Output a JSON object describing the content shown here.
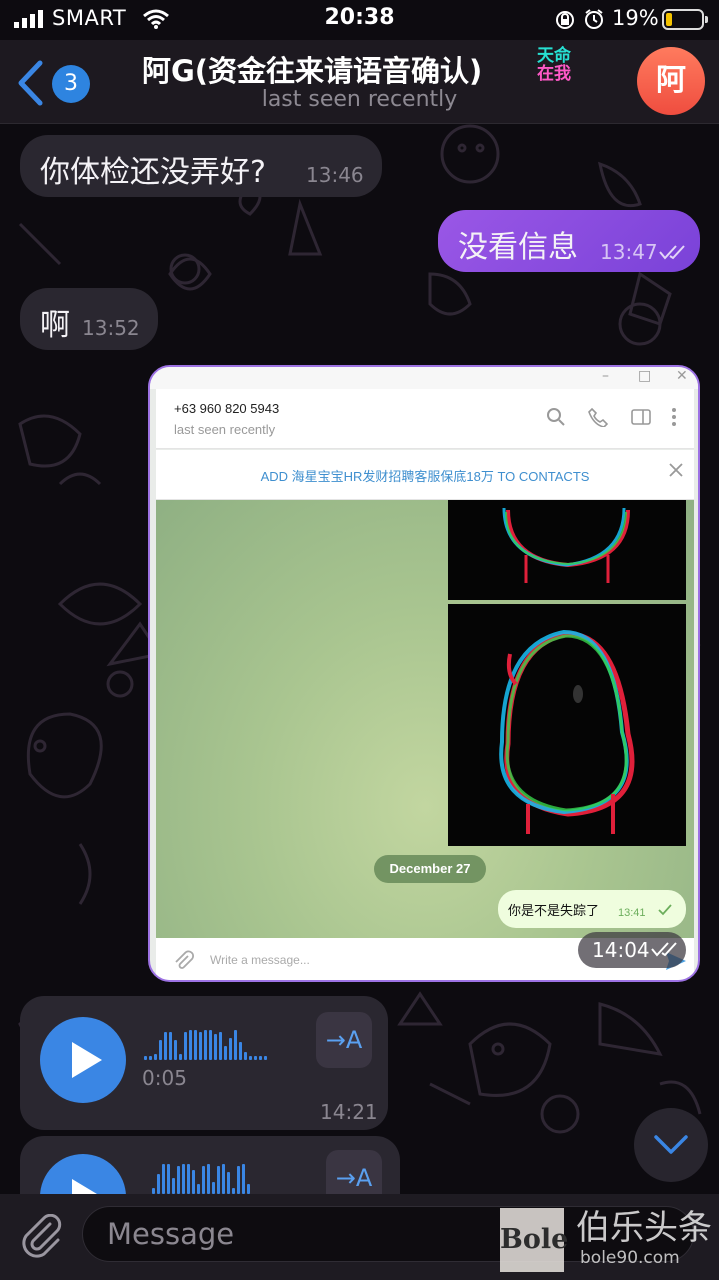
{
  "status_bar": {
    "carrier": "SMART",
    "time": "20:38",
    "battery_percent": "19%",
    "battery_level": 0.19,
    "icons": [
      "signal-icon",
      "wifi-icon",
      "orientation-lock-icon",
      "alarm-icon",
      "battery-icon"
    ]
  },
  "header": {
    "back_count": "3",
    "title": "阿G(资金往来请语音确认)",
    "title_sticker_line1": "天命",
    "title_sticker_line2": "在我",
    "status": "last seen recently",
    "avatar_initial": "阿"
  },
  "messages": [
    {
      "direction": "in",
      "text": "你体检还没弄好?",
      "time": "13:46"
    },
    {
      "direction": "out",
      "text": "没看信息",
      "time": "13:47",
      "read": true
    },
    {
      "direction": "in",
      "text": "啊",
      "time": "13:52"
    }
  ],
  "image_message": {
    "time": "14:04",
    "read": true,
    "screenshot": {
      "contact_phone": "+63 960 820 5943",
      "contact_status": "last seen recently",
      "add_contact_banner": "ADD 海星宝宝HR发财招聘客服保底18万 TO CONTACTS",
      "date_separator": "December 27",
      "message_text": "你是不是失踪了",
      "message_time": "13:41",
      "compose_placeholder": "Write a message..."
    }
  },
  "voice_messages": [
    {
      "duration": "0:05",
      "time": "14:21",
      "transcribe_label": "→A"
    },
    {
      "duration": "",
      "time": "",
      "transcribe_label": "→A"
    }
  ],
  "input": {
    "placeholder": "Message"
  },
  "watermark": {
    "logo": "Bole",
    "title": "伯乐头条",
    "url": "bole90.com"
  },
  "colors": {
    "accent": "#3a86e4",
    "outgoing_bubble": "#8a4de0",
    "incoming_bubble": "#2a2730",
    "background": "#0d0b10",
    "battery_fill": "#f3c200"
  }
}
